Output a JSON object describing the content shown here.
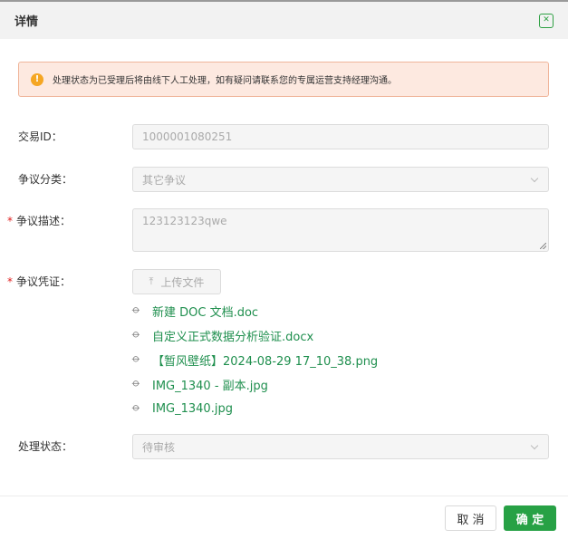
{
  "header": {
    "title": "详情",
    "close_icon": "close-icon"
  },
  "alert": {
    "icon": "warning-icon",
    "text": "处理状态为已受理后将由线下人工处理，如有疑问请联系您的专属运营支持经理沟通。"
  },
  "form": {
    "transaction_id": {
      "label": "交易ID：",
      "value": "1000001080251"
    },
    "dispute_category": {
      "label": "争议分类：",
      "value": "其它争议"
    },
    "dispute_description": {
      "label": "争议描述：",
      "required_mark": "*",
      "value": "123123123qwe"
    },
    "dispute_evidence": {
      "label": "争议凭证：",
      "required_mark": "*",
      "upload_label": "上传文件",
      "files": [
        "新建 DOC 文档.doc",
        "自定义正式数据分析验证.docx",
        "【暂风壁纸】2024-08-29 17_10_38.png",
        "IMG_1340 - 副本.jpg",
        "IMG_1340.jpg"
      ]
    },
    "processing_status": {
      "label": "处理状态：",
      "value": "待审核"
    }
  },
  "footer": {
    "cancel_label": "取 消",
    "confirm_label": "确 定"
  },
  "colors": {
    "accent": "#27a145",
    "alert_bg": "#fde9e0",
    "alert_border": "#f0b59a",
    "required": "#e02020"
  }
}
